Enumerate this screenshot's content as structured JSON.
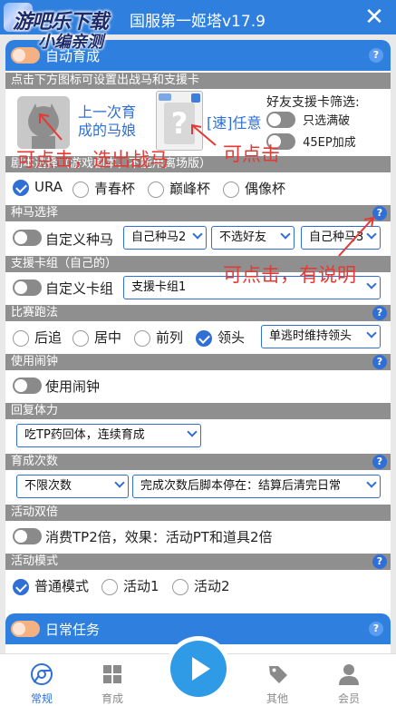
{
  "window": {
    "title": "国服第一姬塔v17.9",
    "watermark_line1": "游吧乐下载",
    "watermark_line2": "小编亲测"
  },
  "auto_train": {
    "label": "自动育成",
    "hint": "点击下方图标可设置出战马和支援卡",
    "horse_label": "上一次育成的马娘",
    "card_label": "[速]任意",
    "friend_filter_label": "好友支援卡筛选:",
    "friend_filter_opt1": "只选满破",
    "friend_filter_opt2": "45EP加成"
  },
  "scenario": {
    "header": "剧本选择（游戏剧本，不能用离场版）",
    "options": [
      "URA",
      "青春杯",
      "巅峰杯",
      "偶像杯"
    ],
    "selected": "URA"
  },
  "seed": {
    "header": "种马选择",
    "custom_label": "自定义种马",
    "select1": "自己种马2",
    "select2": "不选好友",
    "select3": "自己种马3"
  },
  "support_group": {
    "header": "支援卡组（自己的）",
    "custom_label": "自定义卡组",
    "select": "支援卡组1"
  },
  "race_style": {
    "header": "比赛跑法",
    "options": [
      "后追",
      "居中",
      "前列",
      "领头"
    ],
    "selected": "领头",
    "select": "单逃时维持领头"
  },
  "alarm": {
    "header": "使用闹钟",
    "label": "使用闹钟"
  },
  "recover": {
    "header": "回复体力",
    "select": "吃TP药回体，连续育成"
  },
  "train_count": {
    "header": "育成次数",
    "select1": "不限次数",
    "select2": "完成次数后脚本停在：结算后清完日常"
  },
  "event_double": {
    "header": "活动双倍",
    "label": "消费TP2倍，效果：活动PT和道具2倍"
  },
  "event_mode": {
    "header": "活动模式",
    "options": [
      "普通模式",
      "活动1",
      "活动2"
    ],
    "selected": "普通模式"
  },
  "daily": {
    "label": "日常任务"
  },
  "annotations": {
    "note1": "可点击，选出战马",
    "note2": "可点击",
    "note3": "可点击，有说明"
  },
  "nav": {
    "items": [
      "常规",
      "育成",
      "其他",
      "会员"
    ],
    "active": "常规"
  },
  "colors": {
    "accent": "#2f80de",
    "section_gray": "#8f8f8f",
    "annotation_red": "#e53935"
  },
  "icons": [
    "close-icon",
    "help-icon",
    "play-icon",
    "chrome-icon",
    "grid-icon",
    "tag-icon",
    "user-icon"
  ]
}
